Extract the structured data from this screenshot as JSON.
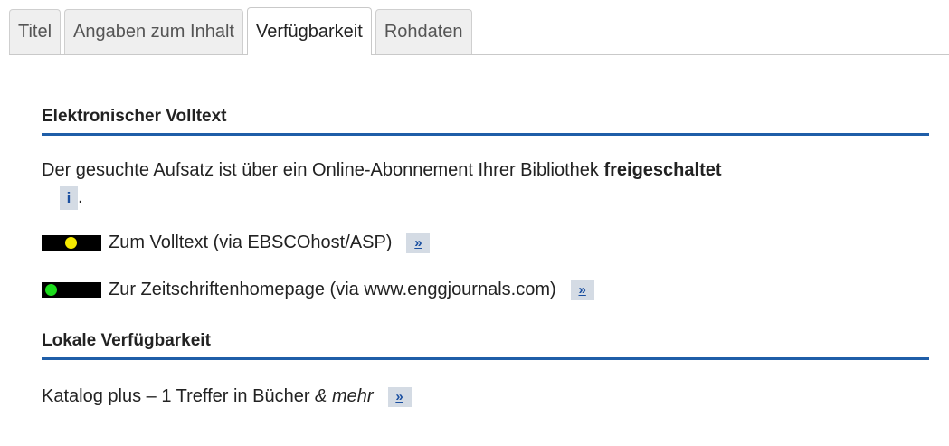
{
  "tabs": [
    {
      "label": "Titel"
    },
    {
      "label": "Angaben zum Inhalt"
    },
    {
      "label": "Verfügbarkeit",
      "active": true
    },
    {
      "label": "Rohdaten"
    }
  ],
  "electronic": {
    "heading": "Elektronischer Volltext",
    "text_before": "Der gesuchte Aufsatz ist über ein Online-Abonnement Ihrer Bibliothek",
    "text_bold": "freigeschaltet",
    "info_label": "i",
    "text_after": ".",
    "links": [
      {
        "label": "Zum Volltext (via EBSCOhost/ASP)",
        "button": "»",
        "light_color": "#f5ea00",
        "light": "yellow"
      },
      {
        "label": "Zur Zeitschriftenhomepage (via www.enggjournals.com)",
        "button": "»",
        "light_color": "#1ddc1d",
        "light": "green"
      }
    ]
  },
  "local": {
    "heading": "Lokale Verfügbarkeit",
    "text": "Katalog plus – 1 Treffer in Bücher",
    "text_italic": "& mehr",
    "button": "»"
  },
  "colors": {
    "accent": "#1f5ea8"
  }
}
